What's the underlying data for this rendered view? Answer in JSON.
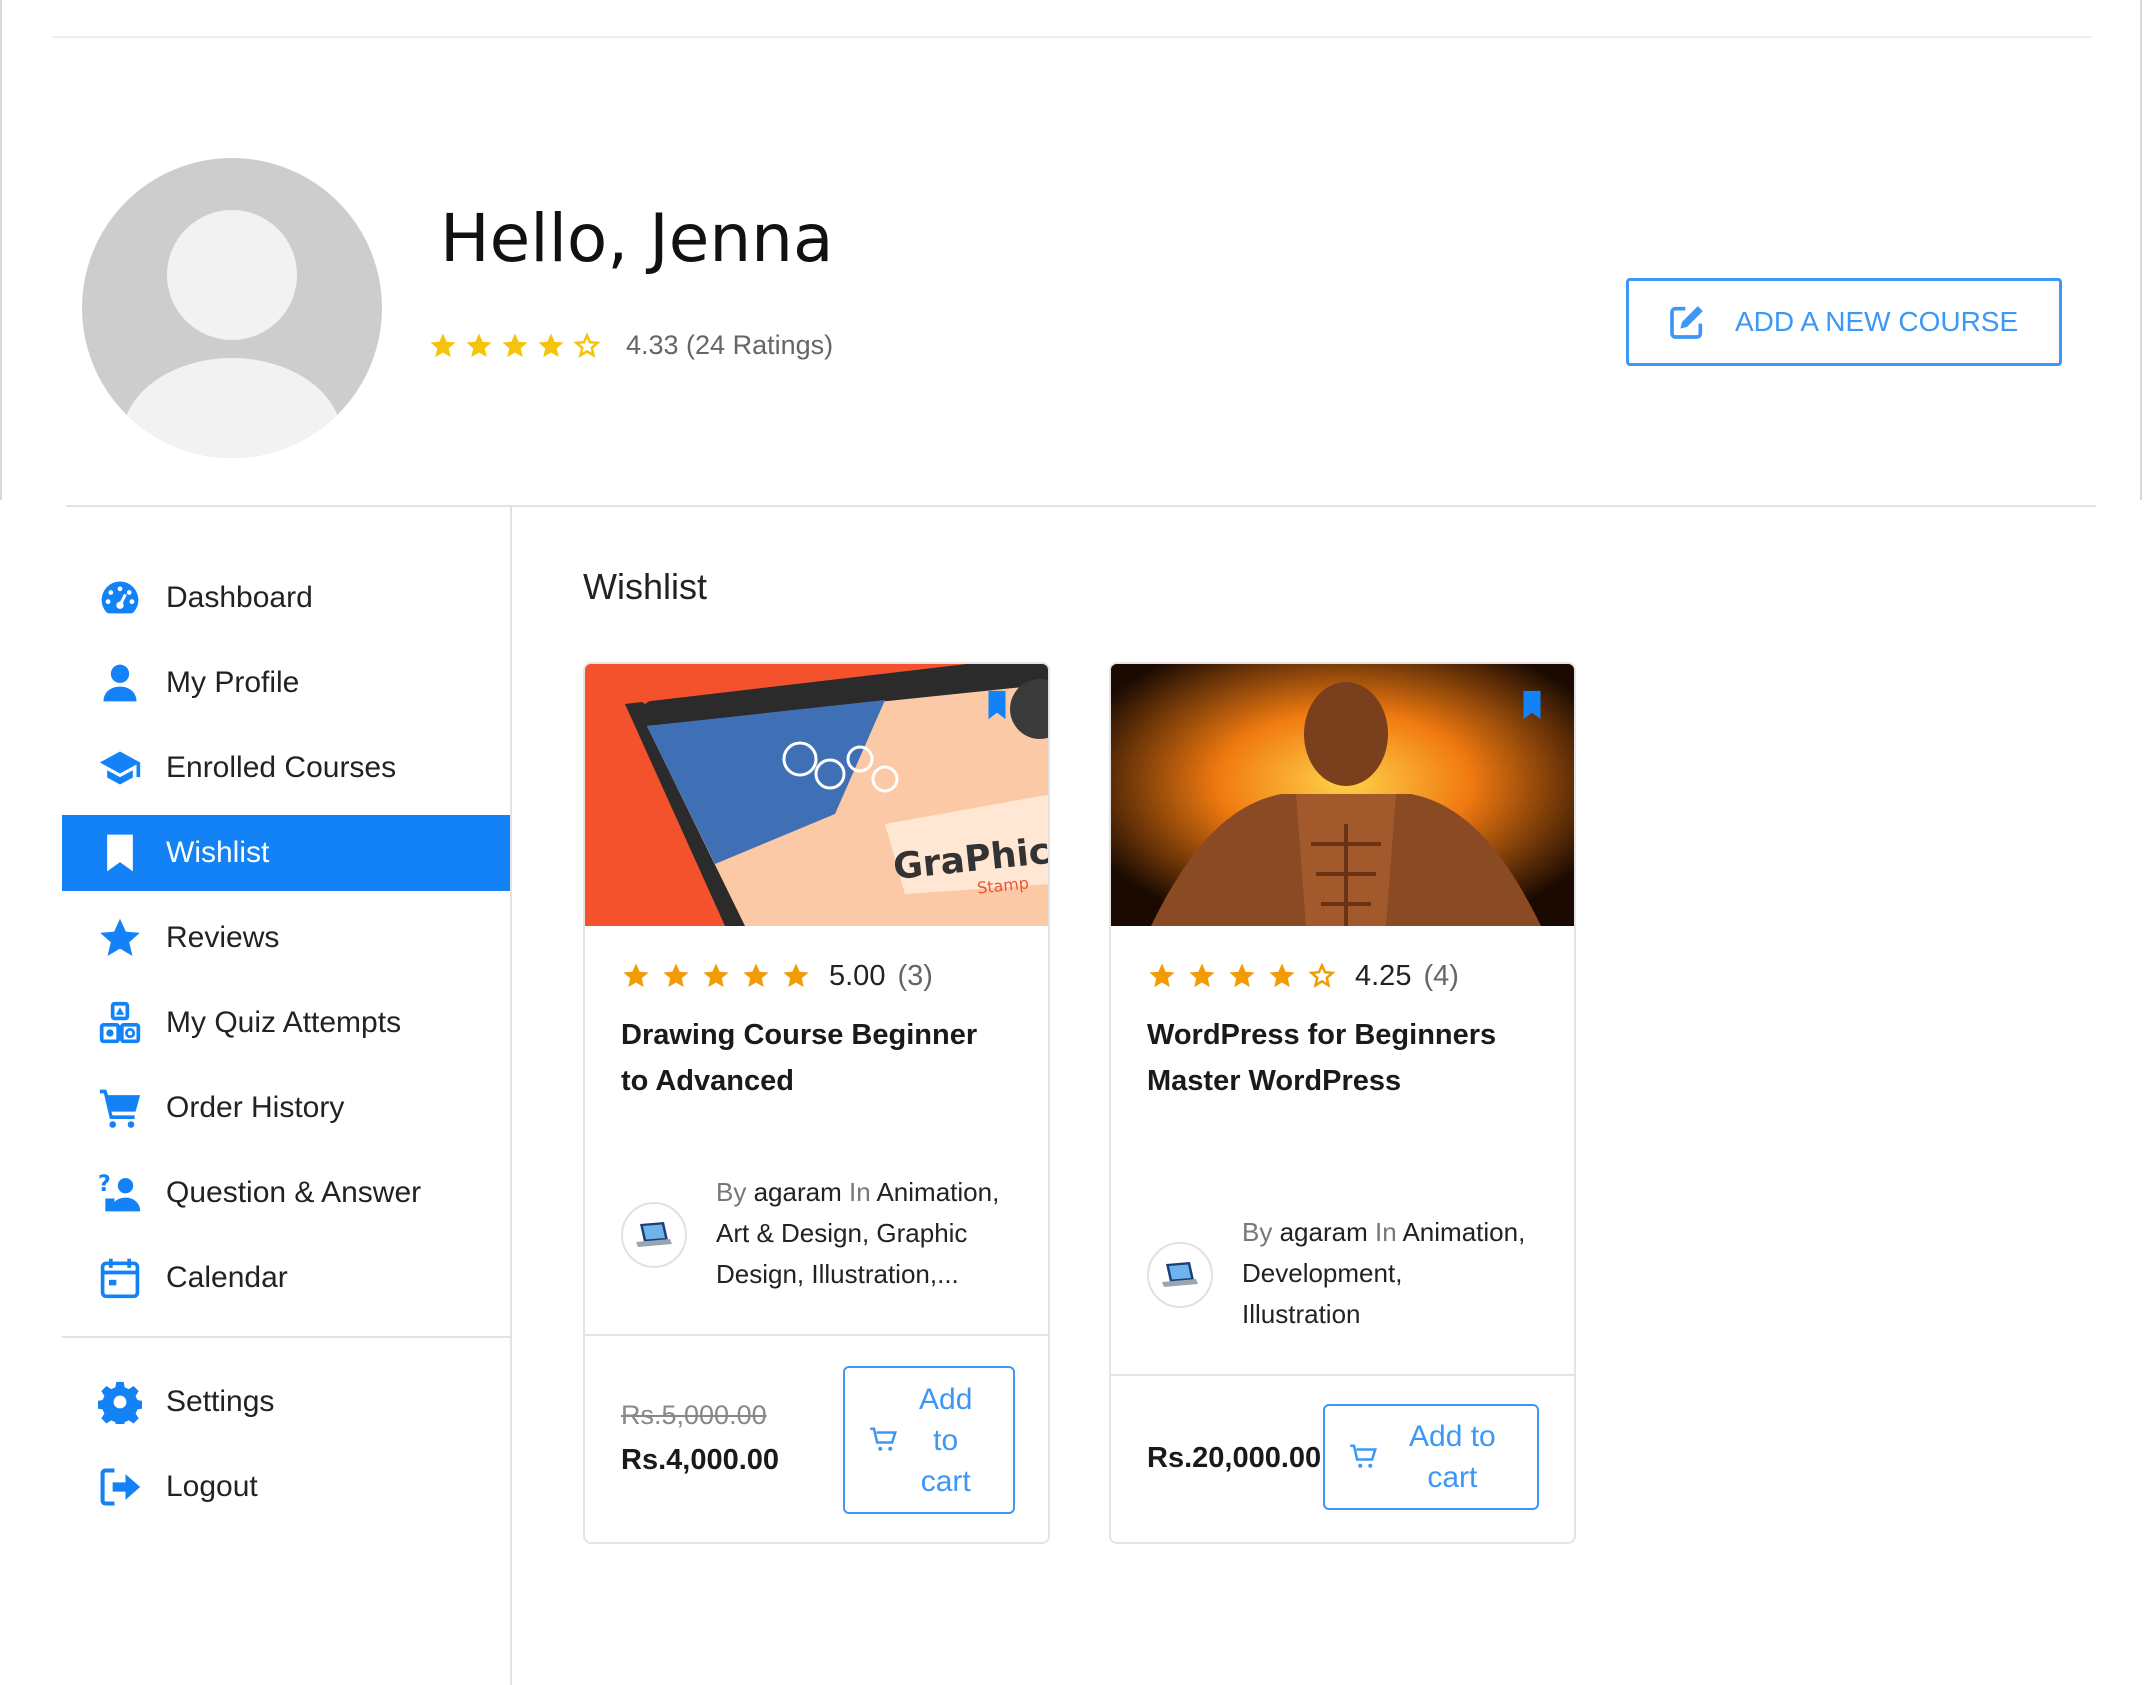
{
  "header": {
    "greeting": "Hello, Jenna",
    "rating_text": "4.33 (24 Ratings)",
    "rating_value": 4.33,
    "add_course_label": "ADD A NEW COURSE"
  },
  "colors": {
    "accent": "#1282f6",
    "button_border": "#3d97f5",
    "star": "#f29b05",
    "header_star": "#f5c30a"
  },
  "sidebar": {
    "items": [
      {
        "label": "Dashboard",
        "icon": "dashboard-icon"
      },
      {
        "label": "My Profile",
        "icon": "user-icon"
      },
      {
        "label": "Enrolled Courses",
        "icon": "graduation-cap-icon"
      },
      {
        "label": "Wishlist",
        "icon": "bookmark-icon",
        "active": true
      },
      {
        "label": "Reviews",
        "icon": "star-icon"
      },
      {
        "label": "My Quiz Attempts",
        "icon": "quiz-shapes-icon"
      },
      {
        "label": "Order History",
        "icon": "cart-icon"
      },
      {
        "label": "Question & Answer",
        "icon": "question-user-icon"
      },
      {
        "label": "Calendar",
        "icon": "calendar-icon"
      }
    ],
    "bottom_items": [
      {
        "label": "Settings",
        "icon": "gear-icon"
      },
      {
        "label": "Logout",
        "icon": "logout-icon"
      }
    ]
  },
  "main": {
    "title": "Wishlist",
    "courses": [
      {
        "rating": "5.00",
        "rating_count": "(3)",
        "stars": 5,
        "title_line1": "Drawing Course Beginner",
        "title_line2": "to Advanced",
        "by": "By",
        "author": "agaram",
        "in": "In",
        "categories": [
          "Animation,",
          "Art & Design, Graphic",
          "Design, Illustration,..."
        ],
        "price_old": "Rs.5,000.00",
        "price": "Rs.4,000.00",
        "cart_label": [
          "Add",
          "to",
          "cart"
        ],
        "thumbnail_text": "GraPhic",
        "thumbnail_subtext": "Stamp"
      },
      {
        "rating": "4.25",
        "rating_count": "(4)",
        "stars": 4,
        "title_line1": "WordPress for Beginners",
        "title_line2": "Master WordPress",
        "by": "By",
        "author": "agaram",
        "in": "In",
        "categories": [
          "Animation,",
          "Development,",
          "Illustration"
        ],
        "price": "Rs.20,000.00",
        "cart_label": [
          "Add to",
          "cart"
        ]
      }
    ]
  }
}
